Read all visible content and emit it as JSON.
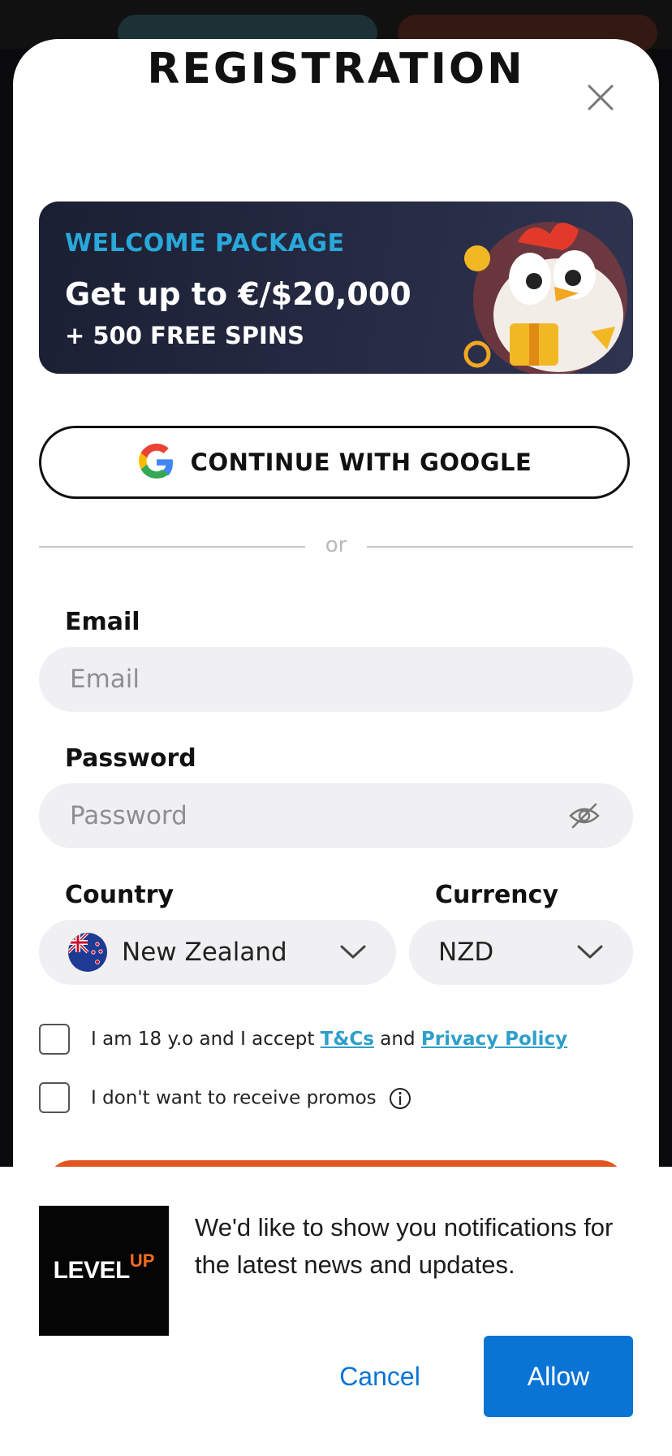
{
  "modal": {
    "title": "REGISTRATION",
    "close_icon": "close-icon"
  },
  "promo": {
    "kicker": "WELCOME PACKAGE",
    "headline": "Get up to €/$20,000",
    "subline": "+ 500 FREE SPINS"
  },
  "google": {
    "label": "CONTINUE WITH GOOGLE",
    "icon": "google-icon"
  },
  "divider": {
    "text": "or"
  },
  "form": {
    "email_label": "Email",
    "email_placeholder": "Email",
    "password_label": "Password",
    "password_placeholder": "Password",
    "country_label": "Country",
    "country_value": "New Zealand",
    "currency_label": "Currency",
    "currency_value": "NZD"
  },
  "consent": {
    "age_prefix": "I am 18 y.o and I accept",
    "tcs_link": "T&Cs",
    "and_text": "and",
    "privacy_link": "Privacy Policy",
    "promos_text": "I don't want to receive promos"
  },
  "notification": {
    "logo_level": "LEVEL",
    "logo_up": "UP",
    "message": "We'd like to show you notifications for the latest news and updates.",
    "cancel_label": "Cancel",
    "allow_label": "Allow"
  },
  "colors": {
    "accent_blue": "#29a8d9",
    "link_blue": "#2e9fc9",
    "allow_blue": "#0a74d4",
    "brand_orange": "#e0561e"
  }
}
